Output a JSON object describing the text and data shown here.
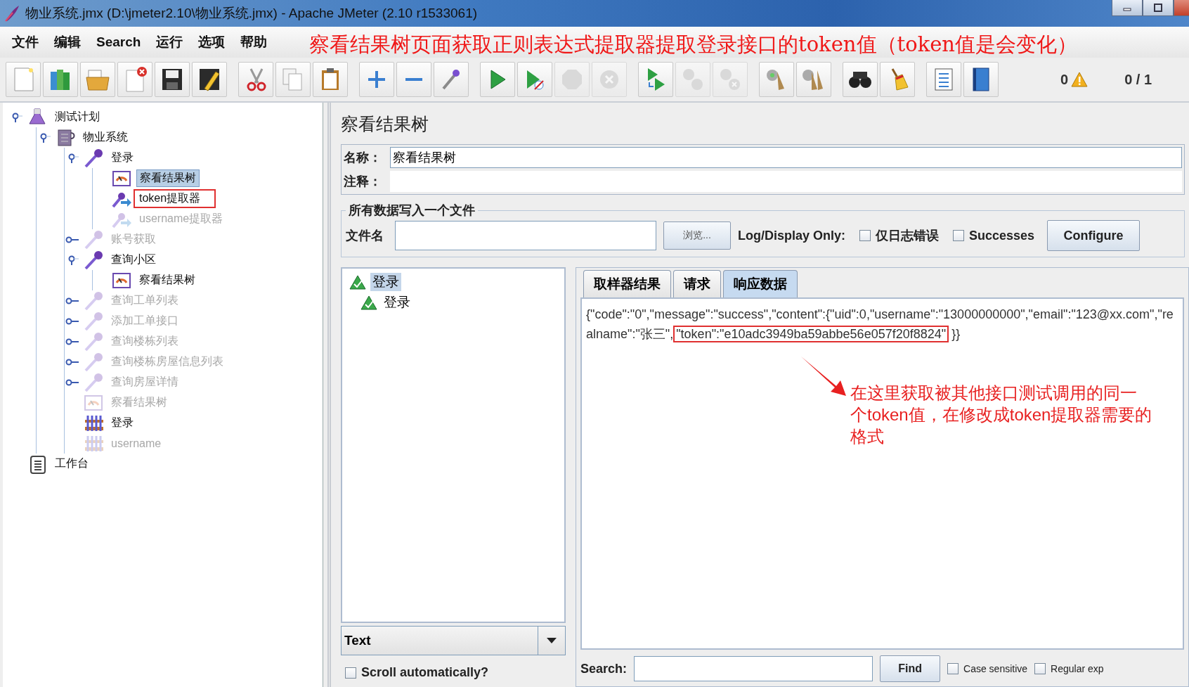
{
  "window": {
    "title": "物业系统.jmx (D:\\jmeter2.10\\物业系统.jmx) - Apache JMeter (2.10 r1533061)"
  },
  "menu": [
    "文件",
    "编辑",
    "Search",
    "运行",
    "选项",
    "帮助"
  ],
  "toolbar": {
    "groups": [
      [
        {
          "kind": "new",
          "disabled": false
        },
        {
          "kind": "templates",
          "disabled": false
        },
        {
          "kind": "open",
          "disabled": false
        },
        {
          "kind": "close",
          "disabled": false
        },
        {
          "kind": "save",
          "disabled": false
        },
        {
          "kind": "save-as",
          "disabled": false
        }
      ],
      [
        {
          "kind": "cut",
          "disabled": false
        },
        {
          "kind": "copy",
          "disabled": false
        },
        {
          "kind": "paste",
          "disabled": false
        }
      ],
      [
        {
          "kind": "expand",
          "disabled": false
        },
        {
          "kind": "collapse",
          "disabled": false
        },
        {
          "kind": "toggle",
          "disabled": false
        }
      ],
      [
        {
          "kind": "start",
          "disabled": false
        },
        {
          "kind": "start-no-pause",
          "disabled": false
        },
        {
          "kind": "stop",
          "disabled": true
        },
        {
          "kind": "shutdown",
          "disabled": true
        }
      ],
      [
        {
          "kind": "remote-start",
          "disabled": false
        },
        {
          "kind": "remote-stop",
          "disabled": true
        },
        {
          "kind": "remote-shutdown",
          "disabled": true
        }
      ],
      [
        {
          "kind": "clear",
          "disabled": false
        },
        {
          "kind": "clear-all",
          "disabled": false
        }
      ],
      [
        {
          "kind": "search",
          "disabled": false
        },
        {
          "kind": "reset-search",
          "disabled": false
        }
      ],
      [
        {
          "kind": "functions",
          "disabled": false
        },
        {
          "kind": "help",
          "disabled": false
        }
      ]
    ],
    "error_count": "0",
    "thread_count": "0 / 1"
  },
  "tree": [
    {
      "label": "测试计划",
      "kind": "plan",
      "enabled": true,
      "selected": false,
      "marked": false,
      "expanded": true,
      "children": [
        {
          "label": "物业系统",
          "kind": "thread-group",
          "enabled": true,
          "selected": false,
          "marked": false,
          "expanded": true,
          "children": [
            {
              "label": "登录",
              "kind": "sampler",
              "enabled": true,
              "selected": false,
              "marked": false,
              "expanded": true,
              "children": [
                {
                  "label": "察看结果树",
                  "kind": "listener",
                  "enabled": true,
                  "selected": true,
                  "marked": false
                },
                {
                  "label": "token提取器",
                  "kind": "extractor",
                  "enabled": true,
                  "selected": false,
                  "marked": true
                },
                {
                  "label": "username提取器",
                  "kind": "extractor",
                  "enabled": false,
                  "selected": false,
                  "marked": false
                }
              ]
            },
            {
              "label": "账号获取",
              "kind": "sampler",
              "enabled": false,
              "selected": false,
              "marked": false,
              "expanded": false
            },
            {
              "label": "查询小区",
              "kind": "sampler",
              "enabled": true,
              "selected": false,
              "marked": false,
              "expanded": true,
              "children": [
                {
                  "label": "察看结果树",
                  "kind": "listener",
                  "enabled": true,
                  "selected": false,
                  "marked": false
                }
              ]
            },
            {
              "label": "查询工单列表",
              "kind": "sampler",
              "enabled": false,
              "selected": false,
              "marked": false,
              "expanded": false
            },
            {
              "label": "添加工单接口",
              "kind": "sampler",
              "enabled": false,
              "selected": false,
              "marked": false,
              "expanded": false
            },
            {
              "label": "查询楼栋列表",
              "kind": "sampler",
              "enabled": false,
              "selected": false,
              "marked": false,
              "expanded": false
            },
            {
              "label": "查询楼栋房屋信息列表",
              "kind": "sampler",
              "enabled": false,
              "selected": false,
              "marked": false,
              "expanded": false
            },
            {
              "label": "查询房屋详情",
              "kind": "sampler",
              "enabled": false,
              "selected": false,
              "marked": false,
              "expanded": false
            },
            {
              "label": "察看结果树",
              "kind": "listener",
              "enabled": false,
              "selected": false,
              "marked": false
            },
            {
              "label": "登录",
              "kind": "config",
              "enabled": true,
              "selected": false,
              "marked": false
            },
            {
              "label": "username",
              "kind": "config",
              "enabled": false,
              "selected": false,
              "marked": false
            }
          ]
        }
      ]
    },
    {
      "label": "工作台",
      "kind": "workbench",
      "enabled": true,
      "selected": false,
      "marked": false
    }
  ],
  "viewer": {
    "title": "察看结果树",
    "name_label": "名称：",
    "name_value": "察看结果树",
    "comment_label": "注释：",
    "file_group": "所有数据写入一个文件",
    "file_label": "文件名",
    "browse_button": "浏览...",
    "log_label": "Log/Display Only:",
    "options": [
      {
        "label": "仅日志错误",
        "checked": false
      },
      {
        "label": "Successes",
        "checked": false
      }
    ],
    "configure_button": "Configure",
    "results": [
      {
        "label": "登录",
        "selected": true
      },
      {
        "label": "登录",
        "selected": false
      }
    ],
    "renderer": "Text",
    "scroll_auto": {
      "label": "Scroll automatically?",
      "checked": false
    },
    "tabs": [
      {
        "label": "取样器结果",
        "selected": false
      },
      {
        "label": "请求",
        "selected": false
      },
      {
        "label": "响应数据",
        "selected": true
      }
    ],
    "response": {
      "text_before": "{\"code\":\"0\",\"message\":\"success\",\"content\":{\"uid\":0,\"username\":\"13000000000\",\"email\":\"123@xx.com\",\"realname\":\"张三\",",
      "highlighted": "\"token\":\"e10adc3949ba59abbe56e057f20f8824\"",
      "text_after": "}}"
    },
    "search_label": "Search:",
    "find_button": "Find",
    "search_options": [
      {
        "label": "Case sensitive",
        "checked": false
      },
      {
        "label": "Regular exp",
        "checked": false
      }
    ]
  },
  "annotations": {
    "headline": "察看结果树页面获取正则表达式提取器提取登录接口的token值（token值是会变化）",
    "note": "在这里获取被其他接口测试调用的同一个token值，在修改成token提取器需要的格式"
  }
}
